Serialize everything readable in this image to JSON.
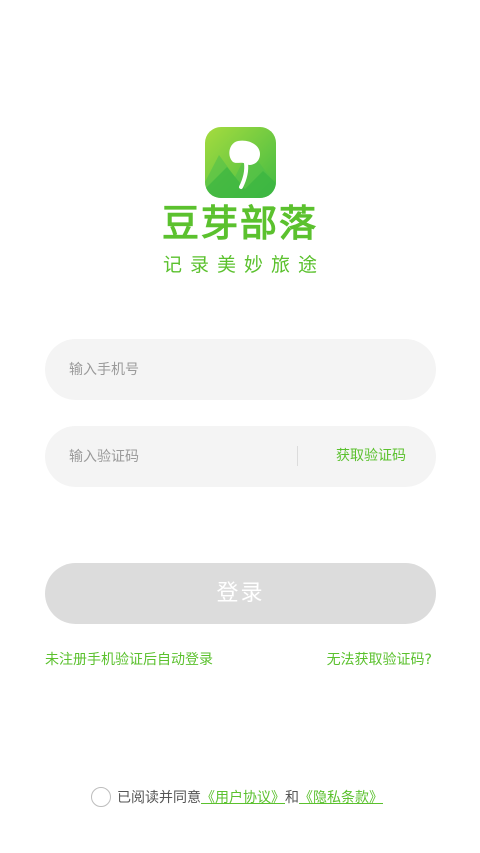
{
  "brand": {
    "app_icon": "bean-sprout-logo-icon",
    "app_name": "豆芽部落",
    "slogan": "记录美妙旅途"
  },
  "form": {
    "phone_placeholder": "输入手机号",
    "code_placeholder": "输入验证码",
    "get_code_label": "获取验证码",
    "login_label": "登录"
  },
  "links": {
    "auto_login_note": "未注册手机验证后自动登录",
    "no_code": "无法获取验证码?"
  },
  "agreement": {
    "prefix": "已阅读并同意",
    "user_agreement": "《用户协议》",
    "conjunction": "和",
    "privacy_policy": "《隐私条款》",
    "checked": false
  },
  "colors": {
    "brand_green": "#5bc12e",
    "input_background": "#f4f4f4",
    "disabled_button": "#dcdcdc"
  }
}
